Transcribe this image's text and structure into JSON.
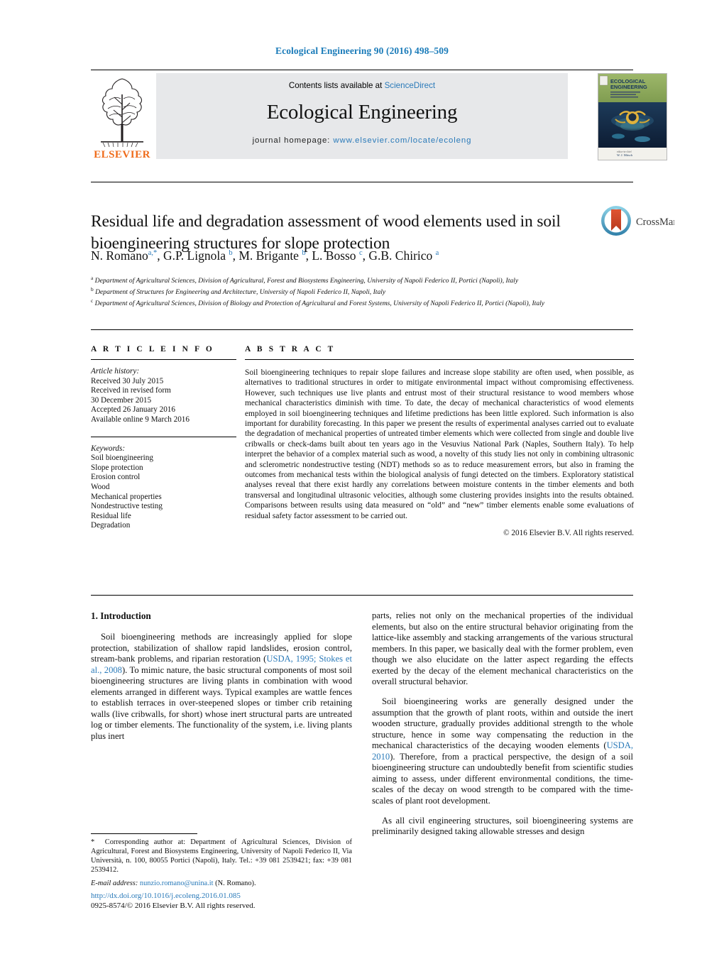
{
  "running_head": "Ecological Engineering 90 (2016) 498–509",
  "masthead": {
    "contents_prefix": "Contents lists available at ",
    "sciencedirect": "ScienceDirect",
    "journal_name": "Ecological Engineering",
    "homepage_prefix": "journal homepage:",
    "homepage_url": "www.elsevier.com/locate/ecoleng",
    "publisher": "ELSEVIER",
    "cover_title_line1": "ECOLOGICAL",
    "cover_title_line2": "ENGINEERING"
  },
  "crossmark": {
    "label": "CrossMark"
  },
  "article": {
    "title": "Residual life and degradation assessment of wood elements used in soil bioengineering structures for slope protection",
    "authors_html": "N. Romano<sup>a,*</sup>, G.P. Lignola <sup>b</sup>, M. Brigante <sup>b</sup>, L. Bosso <sup>c</sup>, G.B. Chirico <sup>a</sup>",
    "affiliations": [
      "a Department of Agricultural Sciences, Division of Agricultural, Forest and Biosystems Engineering, University of Napoli Federico II, Portici (Napoli), Italy",
      "b Department of Structures for Engineering and Architecture, University of Napoli Federico II, Napoli, Italy",
      "c Department of Agricultural Sciences, Division of Biology and Protection of Agricultural and Forest Systems, University of Napoli Federico II, Portici (Napoli), Italy"
    ]
  },
  "article_info": {
    "heading": "A R T I C L E   I N F O",
    "history_label": "Article history:",
    "history": [
      "Received 30 July 2015",
      "Received in revised form",
      "30 December 2015",
      "Accepted 26 January 2016",
      "Available online 9 March 2016"
    ],
    "keywords_label": "Keywords:",
    "keywords": [
      "Soil bioengineering",
      "Slope protection",
      "Erosion control",
      "Wood",
      "Mechanical properties",
      "Nondestructive testing",
      "Residual life",
      "Degradation"
    ]
  },
  "abstract": {
    "heading": "A B S T R A C T",
    "text": "Soil bioengineering techniques to repair slope failures and increase slope stability are often used, when possible, as alternatives to traditional structures in order to mitigate environmental impact without compromising effectiveness. However, such techniques use live plants and entrust most of their structural resistance to wood members whose mechanical characteristics diminish with time. To date, the decay of mechanical characteristics of wood elements employed in soil bioengineering techniques and lifetime predictions has been little explored. Such information is also important for durability forecasting. In this paper we present the results of experimental analyses carried out to evaluate the degradation of mechanical properties of untreated timber elements which were collected from single and double live cribwalls or check-dams built about ten years ago in the Vesuvius National Park (Naples, Southern Italy). To help interpret the behavior of a complex material such as wood, a novelty of this study lies not only in combining ultrasonic and sclerometric nondestructive testing (NDT) methods so as to reduce measurement errors, but also in framing the outcomes from mechanical tests within the biological analysis of fungi detected on the timbers. Exploratory statistical analyses reveal that there exist hardly any correlations between moisture contents in the timber elements and both transversal and longitudinal ultrasonic velocities, although some clustering provides insights into the results obtained. Comparisons between results using data measured on “old” and “new” timber elements enable some evaluations of residual safety factor assessment to be carried out.",
    "copyright": "© 2016 Elsevier B.V. All rights reserved."
  },
  "body": {
    "section_number_title": "1.  Introduction",
    "left_paragraphs": [
      "Soil bioengineering methods are increasingly applied for slope protection, stabilization of shallow rapid landslides, erosion control, stream-bank problems, and riparian restoration (USDA, 1995; Stokes et al., 2008). To mimic nature, the basic structural components of most soil bioengineering structures are living plants in combination with wood elements arranged in different ways. Typical examples are wattle fences to establish terraces in over-steepened slopes or timber crib retaining walls (live cribwalls, for short) whose inert structural parts are untreated log or timber elements. The functionality of the system, i.e. living plants plus inert"
    ],
    "left_refs": [
      "USDA, 1995;",
      "Stokes et al., 2008"
    ],
    "right_paragraphs": [
      "parts, relies not only on the mechanical properties of the individual elements, but also on the entire structural behavior originating from the lattice-like assembly and stacking arrangements of the various structural members. In this paper, we basically deal with the former problem, even though we also elucidate on the latter aspect regarding the effects exerted by the decay of the element mechanical characteristics on the overall structural behavior.",
      "Soil bioengineering works are generally designed under the assumption that the growth of plant roots, within and outside the inert wooden structure, gradually provides additional strength to the whole structure, hence in some way compensating the reduction in the mechanical characteristics of the decaying wooden elements (USDA, 2010). Therefore, from a practical perspective, the design of a soil bioengineering structure can undoubtedly benefit from scientific studies aiming to assess, under different environmental conditions, the time-scales of the decay on wood strength to be compared with the time-scales of plant root development.",
      "As all civil engineering structures, soil bioengineering systems are preliminarily designed taking allowable stresses and design"
    ],
    "right_refs": [
      "USDA, 2010"
    ]
  },
  "footnote": {
    "marker": "*",
    "text": "Corresponding author at: Department of Agricultural Sciences, Division of Agricultural, Forest and Biosystems Engineering, University of Napoli Federico II, Via Università, n. 100, 80055 Portici (Napoli), Italy. Tel.: +39 081 2539421; fax: +39 081 2539412.",
    "email_label": "E-mail address:",
    "email": "nunzio.romano@unina.it",
    "email_person": "(N. Romano)."
  },
  "doi": {
    "url": "http://dx.doi.org/10.1016/j.ecoleng.2016.01.085",
    "issn_line": "0925-8574/© 2016 Elsevier B.V. All rights reserved."
  },
  "colors": {
    "link": "#2a7ab9",
    "masthead_bg": "#e7e8ea",
    "text": "#111111"
  }
}
